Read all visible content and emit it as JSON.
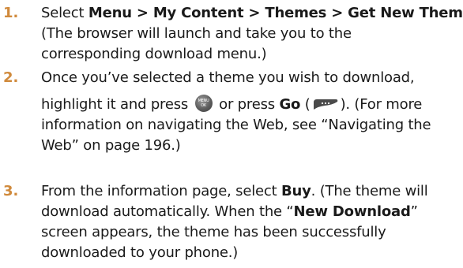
{
  "steps": [
    {
      "number": "1.",
      "lines": [
        {
          "pre": "Select ",
          "bold": "Menu > My Content > Themes > Get New Themes",
          "post": "."
        },
        {
          "text": "(The browser will launch and take you to the"
        },
        {
          "text": "corresponding download menu.)"
        }
      ]
    },
    {
      "number": "2.",
      "lines": [
        {
          "text": "Once you’ve selected a theme you wish to download,"
        },
        {
          "pre": "highlight it and press ",
          "mid": " or press ",
          "bold": "Go",
          "mid2": " (",
          "post": "). (For more"
        },
        {
          "text": "information on navigating the Web, see “Navigating the"
        },
        {
          "text": "Web” on page 196.)"
        }
      ]
    },
    {
      "number": "3.",
      "lines": [
        {
          "pre": "From the information page, select ",
          "bold": "Buy",
          "post": ". (The theme will"
        },
        {
          "pre": "download automatically. When the “",
          "bold": "New Download",
          "post": "”"
        },
        {
          "text": "screen appears, the theme has been successfully"
        },
        {
          "text": "downloaded to your phone.)"
        }
      ]
    }
  ],
  "icons": {
    "ok_key": {
      "name": "menu-ok-key-icon",
      "text_top": "MENU",
      "text_bottom": "OK"
    },
    "softkey": {
      "name": "left-softkey-icon"
    }
  },
  "colors": {
    "step_number": "#d08a3c",
    "text": "#1a1a1a"
  }
}
